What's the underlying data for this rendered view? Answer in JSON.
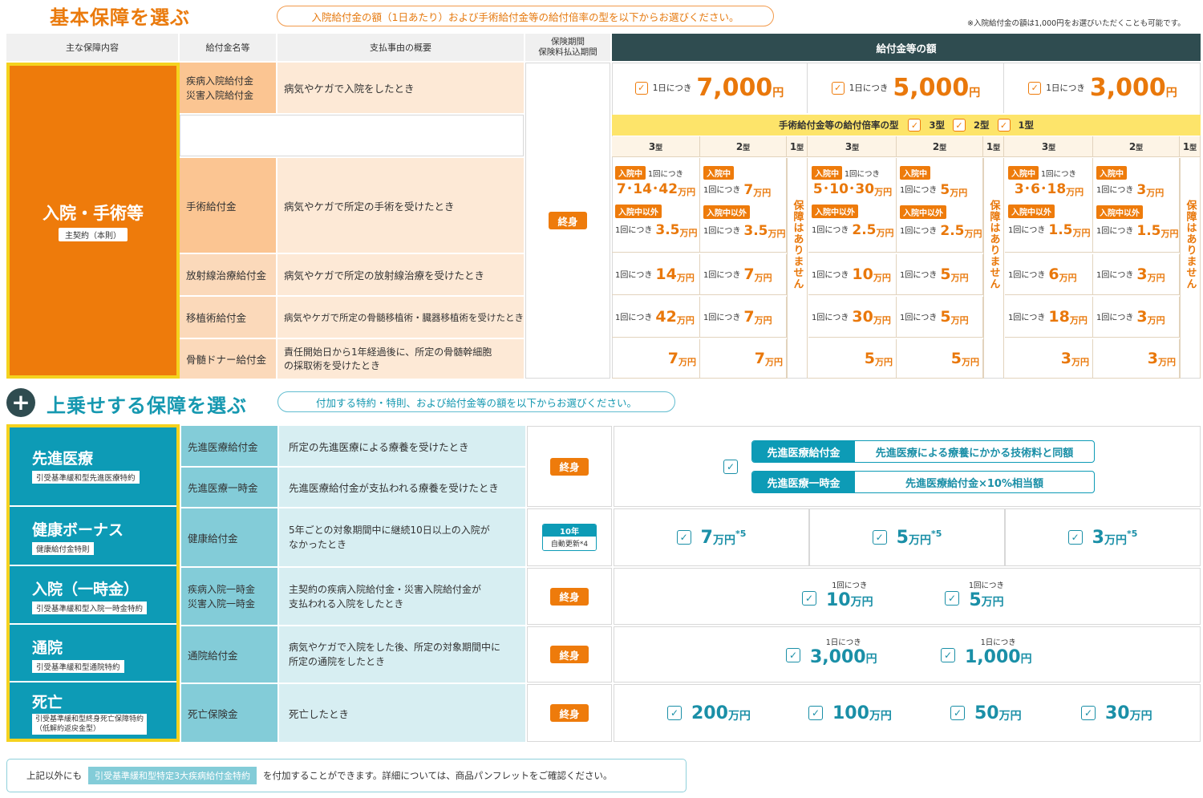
{
  "basic": {
    "title": "基本保障を選ぶ",
    "instruction": "入院給付金の額（1日あたり）および手術給付金等の給付倍率の型を以下からお選びください。",
    "note": "※入院給付金の額は1,000円をお選びいただくことも可能です。",
    "headers": {
      "main": "主な保障内容",
      "benefit": "給付金名等",
      "reason": "支払事由の概要",
      "period1": "保険期間",
      "period2": "保険料払込期間",
      "amount": "給付金等の額"
    },
    "main_label": "入院・手術等",
    "main_sub": "主契約（本則）",
    "term": "終身",
    "rows": [
      {
        "name1": "疾病入院給付金",
        "name2": "災害入院給付金",
        "reason": "病気やケガで入院をしたとき"
      },
      {
        "name": "手術給付金",
        "reason": "病気やケガで所定の手術を受けたとき"
      },
      {
        "name": "放射線治療給付金",
        "reason": "病気やケガで所定の放射線治療を受けたとき"
      },
      {
        "name": "移植術給付金",
        "reason": "病気やケガで所定の骨髄移植術・臓器移植術を受けたとき"
      },
      {
        "name": "骨髄ドナー給付金",
        "reason1": "責任開始日から1年経過後に、所定の骨髄幹細胞",
        "reason2": "の採取術を受けたとき"
      }
    ],
    "per_day": "1日につき",
    "daily": [
      {
        "amount": "7,000",
        "unit": "円"
      },
      {
        "amount": "5,000",
        "unit": "円"
      },
      {
        "amount": "3,000",
        "unit": "円"
      }
    ],
    "multiplier_label": "手術給付金等の給付倍率の型",
    "types": {
      "t3": "3型",
      "t2": "2型",
      "t1": "1型",
      "num3": "3",
      "num2": "2",
      "num1": "1",
      "suffix": "型"
    },
    "in_hosp": "入院中",
    "out_hosp": "入院中以外",
    "per_time": "1回につき",
    "man": "万円",
    "none_text": "保障はありません",
    "groups": [
      {
        "in3": "7･14･42",
        "in2": "7",
        "out3": "3.5",
        "out2": "3.5",
        "rad3": "14",
        "rad2": "7",
        "tr3": "42",
        "tr2": "7",
        "don3": "7",
        "don2": "7"
      },
      {
        "in3": "5･10･30",
        "in2": "5",
        "out3": "2.5",
        "out2": "2.5",
        "rad3": "10",
        "rad2": "5",
        "tr3": "30",
        "tr2": "5",
        "don3": "5",
        "don2": "5"
      },
      {
        "in3": "3･6･18",
        "in2": "3",
        "out3": "1.5",
        "out2": "1.5",
        "rad3": "6",
        "rad2": "3",
        "tr3": "18",
        "tr2": "3",
        "don3": "3",
        "don2": "3"
      }
    ]
  },
  "extra": {
    "title": "上乗せする保障を選ぶ",
    "instruction": "付加する特約・特則、および給付金等の額を以下からお選びください。",
    "advanced": {
      "label": "先進医療",
      "sub": "引受基準緩和型先進医療特約",
      "name1": "先進医療給付金",
      "reason1": "所定の先進医療による療養を受けたとき",
      "name2": "先進医療一時金",
      "reason2": "先進医療給付金が支払われる療養を受けたとき",
      "term": "終身",
      "box1_label": "先進医療給付金",
      "box1_value": "先進医療による療養にかかる技術料と同額",
      "box2_label": "先進医療一時金",
      "box2_value": "先進医療給付金×10%相当額"
    },
    "health": {
      "label": "健康ボーナス",
      "sub": "健康給付金特則",
      "name": "健康給付金",
      "reason1": "5年ごとの対象期間中に継続10日以上の入院が",
      "reason2": "なかったとき",
      "term1": "10年",
      "term2": "自動更新*4",
      "opts": [
        "7",
        "5",
        "3"
      ],
      "unit": "万円",
      "mark": "*5"
    },
    "lump": {
      "label": "入院（一時金）",
      "sub": "引受基準緩和型入院一時金特約",
      "name1": "疾病入院一時金",
      "name2": "災害入院一時金",
      "reason1": "主契約の疾病入院給付金・災害入院給付金が",
      "reason2": "支払われる入院をしたとき",
      "term": "終身",
      "per": "1回につき",
      "opts": [
        "10",
        "5"
      ],
      "unit": "万円"
    },
    "outpatient": {
      "label": "通院",
      "sub": "引受基準緩和型通院特約",
      "name": "通院給付金",
      "reason1": "病気やケガで入院をした後、所定の対象期間中に",
      "reason2": "所定の通院をしたとき",
      "term": "終身",
      "per": "1日につき",
      "opts": [
        "3,000",
        "1,000"
      ],
      "unit": "円"
    },
    "death": {
      "label": "死亡",
      "sub1": "引受基準緩和型終身死亡保障特約",
      "sub2": "（低解約返戻金型）",
      "name": "死亡保険金",
      "reason": "死亡したとき",
      "term": "終身",
      "opts": [
        "200",
        "100",
        "50",
        "30"
      ],
      "unit": "万円"
    }
  },
  "footer": {
    "pre": "上記以外にも",
    "tag": "引受基準緩和型特定3大疾病給付金特約",
    "post": "を付加することができます。詳細については、商品パンフレットをご確認ください。"
  },
  "icons": {
    "check": "check-icon",
    "plus": "plus-circle-icon"
  },
  "colors": {
    "orange": "#ee7b0b",
    "teal": "#0d9bb6",
    "dark": "#2f4c50",
    "yellow": "#fde46a",
    "border": "#f5d21e"
  }
}
